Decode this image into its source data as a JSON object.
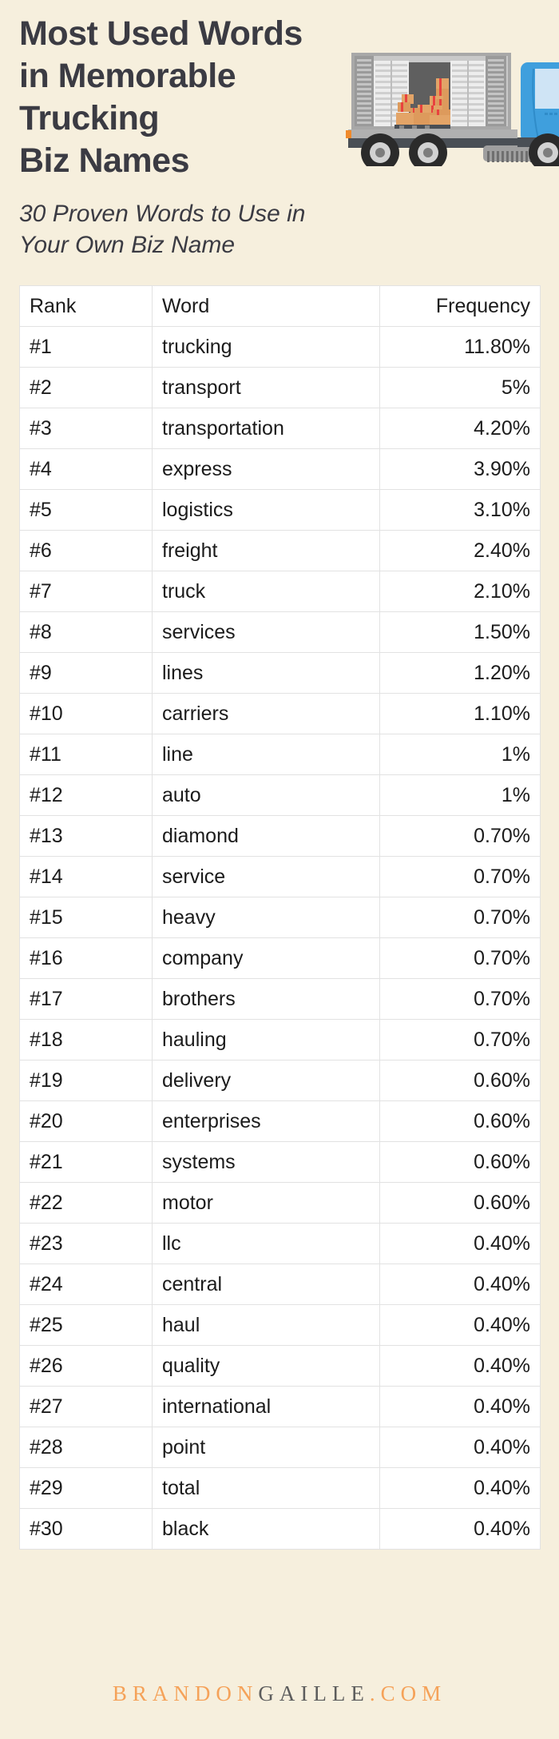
{
  "header": {
    "title_lines": [
      "Most Used Words",
      "in Memorable",
      "Trucking",
      "Biz Names"
    ],
    "subtitle_lines": [
      "30 Proven Words to Use in",
      "Your Own Biz Name"
    ]
  },
  "illustration": {
    "name": "semi-truck-with-boxes-icon",
    "colors": {
      "cab": "#3f9fdd",
      "window": "#cfe4f5",
      "trailer_body": "#b7b7b7",
      "trailer_interior": "#5f5f5f",
      "chassis": "#4a4f55",
      "tire": "#2b2b2b",
      "hub": "#d2d2d2",
      "box": "#e3a467",
      "box_tape": "#e8423f",
      "marker_light": "#f08a2b"
    }
  },
  "table": {
    "columns": [
      "Rank",
      "Word",
      "Frequency"
    ],
    "rows": [
      {
        "rank": "#1",
        "word": "trucking",
        "frequency": "11.80%"
      },
      {
        "rank": "#2",
        "word": "transport",
        "frequency": "5%"
      },
      {
        "rank": "#3",
        "word": "transportation",
        "frequency": "4.20%"
      },
      {
        "rank": "#4",
        "word": "express",
        "frequency": "3.90%"
      },
      {
        "rank": "#5",
        "word": "logistics",
        "frequency": "3.10%"
      },
      {
        "rank": "#6",
        "word": "freight",
        "frequency": "2.40%"
      },
      {
        "rank": "#7",
        "word": "truck",
        "frequency": "2.10%"
      },
      {
        "rank": "#8",
        "word": "services",
        "frequency": "1.50%"
      },
      {
        "rank": "#9",
        "word": "lines",
        "frequency": "1.20%"
      },
      {
        "rank": "#10",
        "word": "carriers",
        "frequency": "1.10%"
      },
      {
        "rank": "#11",
        "word": "line",
        "frequency": "1%"
      },
      {
        "rank": "#12",
        "word": "auto",
        "frequency": "1%"
      },
      {
        "rank": "#13",
        "word": "diamond",
        "frequency": "0.70%"
      },
      {
        "rank": "#14",
        "word": "service",
        "frequency": "0.70%"
      },
      {
        "rank": "#15",
        "word": "heavy",
        "frequency": "0.70%"
      },
      {
        "rank": "#16",
        "word": "company",
        "frequency": "0.70%"
      },
      {
        "rank": "#17",
        "word": "brothers",
        "frequency": "0.70%"
      },
      {
        "rank": "#18",
        "word": "hauling",
        "frequency": "0.70%"
      },
      {
        "rank": "#19",
        "word": "delivery",
        "frequency": "0.60%"
      },
      {
        "rank": "#20",
        "word": "enterprises",
        "frequency": "0.60%"
      },
      {
        "rank": "#21",
        "word": "systems",
        "frequency": "0.60%"
      },
      {
        "rank": "#22",
        "word": "motor",
        "frequency": "0.60%"
      },
      {
        "rank": "#23",
        "word": "llc",
        "frequency": "0.40%"
      },
      {
        "rank": "#24",
        "word": "central",
        "frequency": "0.40%"
      },
      {
        "rank": "#25",
        "word": "haul",
        "frequency": "0.40%"
      },
      {
        "rank": "#26",
        "word": "quality",
        "frequency": "0.40%"
      },
      {
        "rank": "#27",
        "word": "international",
        "frequency": "0.40%"
      },
      {
        "rank": "#28",
        "word": "point",
        "frequency": "0.40%"
      },
      {
        "rank": "#29",
        "word": "total",
        "frequency": "0.40%"
      },
      {
        "rank": "#30",
        "word": "black",
        "frequency": "0.40%"
      }
    ]
  },
  "footer": {
    "part_brandon": "BRANDON",
    "part_gaille": "GAILLE",
    "part_dot": ".",
    "part_com": "COM",
    "color_orange": "#f5a259",
    "color_gray": "#5d5d5d"
  },
  "theme": {
    "background": "#f6efdd",
    "text_dark": "#3b3b43",
    "table_background": "#ffffff",
    "table_border": "#e2e2e2"
  },
  "chart_data": {
    "type": "table",
    "title": "Most Used Words in Memorable Trucking Biz Names",
    "subtitle": "30 Proven Words to Use in Your Own Biz Name",
    "columns": [
      "Rank",
      "Word",
      "Frequency"
    ],
    "categories": [
      "trucking",
      "transport",
      "transportation",
      "express",
      "logistics",
      "freight",
      "truck",
      "services",
      "lines",
      "carriers",
      "line",
      "auto",
      "diamond",
      "service",
      "heavy",
      "company",
      "brothers",
      "hauling",
      "delivery",
      "enterprises",
      "systems",
      "motor",
      "llc",
      "central",
      "haul",
      "quality",
      "international",
      "point",
      "total",
      "black"
    ],
    "values": [
      11.8,
      5.0,
      4.2,
      3.9,
      3.1,
      2.4,
      2.1,
      1.5,
      1.2,
      1.1,
      1.0,
      1.0,
      0.7,
      0.7,
      0.7,
      0.7,
      0.7,
      0.7,
      0.6,
      0.6,
      0.6,
      0.6,
      0.4,
      0.4,
      0.4,
      0.4,
      0.4,
      0.4,
      0.4,
      0.4
    ],
    "ranks": [
      "#1",
      "#2",
      "#3",
      "#4",
      "#5",
      "#6",
      "#7",
      "#8",
      "#9",
      "#10",
      "#11",
      "#12",
      "#13",
      "#14",
      "#15",
      "#16",
      "#17",
      "#18",
      "#19",
      "#20",
      "#21",
      "#22",
      "#23",
      "#24",
      "#25",
      "#26",
      "#27",
      "#28",
      "#29",
      "#30"
    ],
    "xlabel": "Word",
    "ylabel": "Frequency (%)",
    "unit": "%"
  }
}
